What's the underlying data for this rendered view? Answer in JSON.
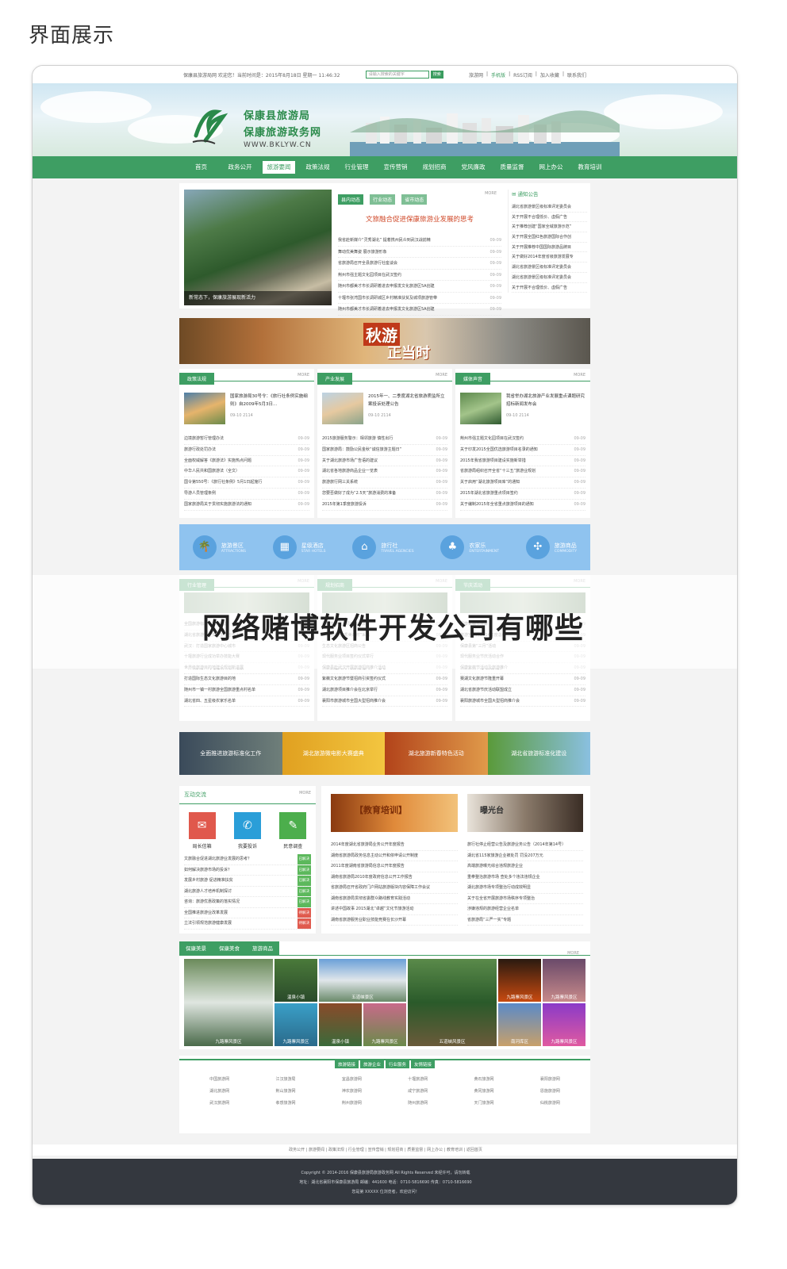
{
  "page": {
    "heading": "界面展示",
    "overlay_title": "网络赌博软件开发公司有哪些"
  },
  "topbar": {
    "left": "保康县旅游局网  欢迎您！当前时间是：2015年8月18日 星期一 11:46:32",
    "search_placeholder": "请输入搜索的关键字",
    "search_button": "搜索",
    "links": [
      "旅游网",
      "手机版",
      "RSS订阅",
      "加入收藏",
      "联系我们"
    ]
  },
  "logo": {
    "line1": "保康县旅游局",
    "line2": "保康旅游政务网",
    "line3": "WWW.BKLYW.CN"
  },
  "nav": [
    "首页",
    "政务公开",
    "旅游要闻",
    "政策法规",
    "行业管理",
    "宣传营销",
    "规划招商",
    "党风廉政",
    "质量监督",
    "网上办公",
    "教育培训"
  ],
  "news": {
    "tabs": [
      "县内动态",
      "行业动态",
      "省市动态"
    ],
    "more": "MORE",
    "photo_caption": "新常态下，保康旅游展现新活力",
    "headline": "文旅融合促进保康旅游业发展的思考",
    "items": [
      {
        "t": "我省赴新媒介“灵秀湖北” 提着携州民众到武汉战前精",
        "d": "09-09"
      },
      {
        "t": "舞动优美舞姿 展示旅游形象",
        "d": "09-09"
      },
      {
        "t": "省旅游局召开全县旅游行社座谈会",
        "d": "09-09"
      },
      {
        "t": "荆州市强主题文化园项目在武汉签约",
        "d": "09-09"
      },
      {
        "t": "随州市都美才市长调研着进去申报发文化旅游区5A创建",
        "d": "09-09"
      },
      {
        "t": "十堰市张湾国市长调研城区乡村精准扶贫及城项旅游管带",
        "d": "09-09"
      },
      {
        "t": "随州市都美才市长调研着进去申报发文化旅游区5A创建",
        "d": "09-09"
      }
    ],
    "notice_title": "通知公告",
    "notices": [
      "湖北省旅游景区级标准评定委员会",
      "关于开展不合理低价、虚假广告",
      "关于推荐创建“国家全域旅游示范”",
      "关于开展全国红色旅游国际合作创",
      "关于开展推荐中国国际旅游品牌目",
      "关于做好2014年度省级旅游发展专",
      "湖北省旅游景区级标准评定委员会",
      "湖北省旅游景区级标准评定委员会",
      "关于开展不合理低价、虚假广告"
    ]
  },
  "ad": {
    "line1": "秋游",
    "line2": "正当时"
  },
  "columns": [
    {
      "title": "政策法规",
      "more": "MORE",
      "excerpt": "国家旅游局30号令：《旅行社条例实施细则》自2009年5月3日...",
      "meta": "09-10  2114",
      "items": [
        {
          "t": "边境旅游暂行管理办法",
          "d": "09-09"
        },
        {
          "t": "旅游行政处罚办法",
          "d": "09-09"
        },
        {
          "t": "全面权威解答《旅游法》实施热点问题",
          "d": "09-09"
        },
        {
          "t": "中华人民共和国旅游法（全文）",
          "d": "09-09"
        },
        {
          "t": "国令第550号：《旅行社条例》5月1日起施行",
          "d": "09-09"
        },
        {
          "t": "导游人员管理条例",
          "d": "09-09"
        },
        {
          "t": "国家旅游局关于贯彻实施旅游法的通知",
          "d": "09-09"
        }
      ]
    },
    {
      "title": "产业发展",
      "more": "MORE",
      "excerpt": "2015年一、二季度湖北省旅游质监所立案投诉处理公告",
      "meta": "09-10  2114",
      "items": [
        {
          "t": "2015旅游服务警示：相邻旅游 慎性出行",
          "d": "09-09"
        },
        {
          "t": "国家旅游局：鼓励公民金秋“诚信旅游主题日”",
          "d": "09-09"
        },
        {
          "t": "关于湖北旅游市场广告语的建议",
          "d": "09-09"
        },
        {
          "t": "湖北省各地旅游商品企业一览表",
          "d": "09-09"
        },
        {
          "t": "旅游旅行网三关系统",
          "d": "09-09"
        },
        {
          "t": "您要否做好了成为“2.5天”旅游消费的准备",
          "d": "09-09"
        },
        {
          "t": "2015年第1季度旅游投诉",
          "d": "09-09"
        }
      ]
    },
    {
      "title": "媒体声音",
      "more": "MORE",
      "excerpt": "我省举办湖北旅游产业发展重点课题研究招标新闻发布会",
      "meta": "09-10  2114",
      "items": [
        {
          "t": "荆州市强主题文化园项目在武汉签约",
          "d": "09-09"
        },
        {
          "t": "关于印发2015全国优选旅游项目名录的通知",
          "d": "09-09"
        },
        {
          "t": "2015年我省旅游项目建设实施新举措",
          "d": "09-09"
        },
        {
          "t": "省旅游局组织召开全省“十三五”旅游业规划",
          "d": "09-09"
        },
        {
          "t": "关于启用“湖北旅游项目库”的通知",
          "d": "09-09"
        },
        {
          "t": "2015年湖北省旅游重点项目签约",
          "d": "09-09"
        },
        {
          "t": "关于编制2015年全省重点旅游项目的通知",
          "d": "09-09"
        }
      ]
    }
  ],
  "services": [
    {
      "icon": "palm-icon",
      "glyph": "🌴",
      "zh": "旅游景区",
      "en": "ATTRACTIONS"
    },
    {
      "icon": "hotel-icon",
      "glyph": "▦",
      "zh": "星级酒店",
      "en": "STAR HOTELS"
    },
    {
      "icon": "agency-icon",
      "glyph": "⌂",
      "zh": "旅行社",
      "en": "TRAVEL AGENCIES"
    },
    {
      "icon": "tree-icon",
      "glyph": "♣",
      "zh": "农家乐",
      "en": "ENTERTAINMENT"
    },
    {
      "icon": "gift-icon",
      "glyph": "✣",
      "zh": "旅游商品",
      "en": "COMMODITY"
    }
  ],
  "columns2": [
    {
      "title": "行业管理",
      "more": "MORE",
      "items": [
        {
          "t": "全国旅游标准化工作会议",
          "d": "09-09"
        },
        {
          "t": "湖北省旅游行业安全生产检查工作",
          "d": "09-09"
        },
        {
          "t": "武汉：打造国家旅游中心城市",
          "d": "09-09"
        },
        {
          "t": "十堰旅游行业成功举办技能大赛",
          "d": "09-09"
        },
        {
          "t": "世界级旅游目的地建设规划新进展",
          "d": "09-09"
        },
        {
          "t": "打造国际生态文化旅游目的地",
          "d": "09-09"
        },
        {
          "t": "随州市一镇一村旅游全国旅游重点村名单",
          "d": "09-09"
        },
        {
          "t": "湖北省四、五星级农家乐名单",
          "d": "09-09"
        }
      ]
    },
    {
      "title": "规划招商",
      "more": "MORE",
      "items": [
        {
          "t": "保康旅游重点项目推介会",
          "d": "09-09"
        },
        {
          "t": "作协旅游行“秀美乡村”采风",
          "d": "09-09"
        },
        {
          "t": "生态文化旅游区招商公告",
          "d": "09-09"
        },
        {
          "t": "现代服务业项目签约仪式举行",
          "d": "09-09"
        },
        {
          "t": "保康县赴武汉开展旅游招商推介活动",
          "d": "09-09"
        },
        {
          "t": "紫薇文化旅游节暨招商引资签约仪式",
          "d": "09-09"
        },
        {
          "t": "湖北旅游项目推介会在北京举行",
          "d": "09-09"
        },
        {
          "t": "襄阳市旅游城市全国大型招商推介会",
          "d": "09-09"
        }
      ]
    },
    {
      "title": "节庆活动",
      "more": "MORE",
      "items": [
        {
          "t": "保康紫薇节开幕",
          "d": "09-09"
        },
        {
          "t": "旅游宣传月2014年度总结",
          "d": "09-09"
        },
        {
          "t": "保康县第“三月”活动",
          "d": "09-09"
        },
        {
          "t": "现代服务业节庆活动合作",
          "d": "09-09"
        },
        {
          "t": "保康紫薇节活动及旅游推介",
          "d": "09-09"
        },
        {
          "t": "赛湖文化旅游节隆重开幕",
          "d": "09-09"
        },
        {
          "t": "湖北省旅游节庆活动联盟成立",
          "d": "09-09"
        },
        {
          "t": "襄阳旅游城市全国大型招商推介会",
          "d": "09-09"
        }
      ]
    }
  ],
  "slides": [
    "全面推进旅游标准化工作",
    "湖北旅游微电影大赛盛典",
    "湖北旅游新春特色活动",
    "湖北省旅游标准化建设"
  ],
  "interaction": {
    "title": "互动交流",
    "more": "MORE",
    "buttons": [
      {
        "label": "局长信箱",
        "icon": "mail-icon",
        "glyph": "✉",
        "color": "#e0584c"
      },
      {
        "label": "我要投诉",
        "icon": "chat-icon",
        "glyph": "✆",
        "color": "#2a9ed8"
      },
      {
        "label": "民意调查",
        "icon": "survey-icon",
        "glyph": "✎",
        "color": "#4cae4c"
      }
    ],
    "items": [
      {
        "t": "文旅融合促进湖北旅游业发展的思考？",
        "b": "已解决",
        "red": false
      },
      {
        "t": "如何解决旅游市场的投诉？",
        "b": "已解决",
        "red": false
      },
      {
        "t": "发展乡村旅游 促进精准扶贫",
        "b": "已解决",
        "red": false
      },
      {
        "t": "湖北旅游人才培养机制探讨",
        "b": "已解决",
        "red": false
      },
      {
        "t": "咨询：旅游优惠政策的落实情况",
        "b": "已解决",
        "red": false
      },
      {
        "t": "全国推进旅游业改革发展",
        "b": "待解决",
        "red": true
      },
      {
        "t": "立法引领规范旅游健康发展",
        "b": "待解决",
        "red": true
      }
    ]
  },
  "edu": {
    "img1_text": "【教育培训】",
    "img2_text": "曝光台",
    "left_items": [
      "2014年度湖北省旅游局业务公开年度报告",
      "湖南省旅游局政务信息主动公开和依申请公开制度",
      "2011年度湖南省旅游局信息公开年度报告",
      "湖南省旅游局2010年度政府信息公开工作报告",
      "省旅游局召开省政府门户网站旅游版块内容保障工作会议",
      "湖南省旅游局贯彻省委群众路线教育实践活动",
      "讲述中国故事 2015湖北“卓越”文化节旅游活动",
      "湖南省旅游服务业职业技能竞赛在长沙开幕"
    ],
    "right_items": [
      "旅行社停止经营公告及旅游业务公告（2014年第14号）",
      "湖北省115家旅游企业被处罚 罚没207万元",
      "高端旅游曝光综合违规旅游企业",
      "重拳整治旅游市场 查处多个违法违规企业",
      "湖北旅游市场专项整治行动成效明显",
      "关于在全省开展旅游市场秩序专项整治",
      "涉嫌违规的旅游经营企业名单",
      "省旅游局“三严一实”专题"
    ]
  },
  "gallery": {
    "tabs": [
      "保康美景",
      "保康美食",
      "旅游商品"
    ],
    "more": "MORE",
    "captions": [
      "九路寨风景区",
      "温泉小镇",
      "五道峡景区",
      "九路寨风景区",
      "温泉小镇",
      "九路寨风景区",
      "五道峡风景区",
      "九路寨风景区",
      "九路寨风景区",
      "南河库区",
      "九路寨风景区"
    ]
  },
  "friend": {
    "tabs": [
      "旅游链接",
      "旅游企业",
      "行业服务",
      "友情链接"
    ],
    "cells": [
      "中国旅游网",
      "江汉旅游局",
      "宜昌旅游网",
      "十堰旅游网",
      "黄石旅游网",
      "襄阳旅游网",
      "湖北旅游网",
      "荆山旅游网",
      "神农旅游网",
      "咸宁旅游网",
      "黄冈旅游网",
      "恩施旅游网",
      "武汉旅游网",
      "孝感旅游网",
      "荆州旅游网",
      "随州旅游网",
      "天门旅游网",
      "仙桃旅游网"
    ]
  },
  "footnav": "政务公开 | 旅游要闻 | 政策法规 | 行业管理 | 宣传营销 | 规划招商 | 质量监督 | 网上办公 | 教育培训 | 返回首页",
  "footer": {
    "line1": "Copyright © 2014-2016 保康县旅游局旅游政务网 All Rights Reserved 未经许可，请勿转载",
    "line2": "地址：湖北省襄阳市保康县旅游局 邮编：441600  电话：0710-5816690  传真：0710-5816690",
    "line3": "您是第 XXXXX 位浏览者，欢迎访问！"
  }
}
